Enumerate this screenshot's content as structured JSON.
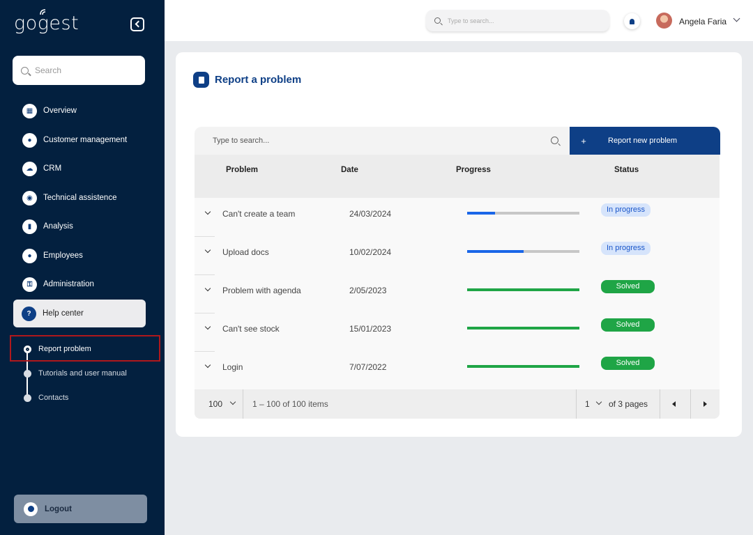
{
  "app": {
    "logo": "gogest"
  },
  "sidebar": {
    "search_placeholder": "Search",
    "items": [
      {
        "label": "Overview",
        "icon": "grid-icon"
      },
      {
        "label": "Customer management",
        "icon": "user-icon"
      },
      {
        "label": "CRM",
        "icon": "cloud-icon"
      },
      {
        "label": "Technical assistence",
        "icon": "headset-icon"
      },
      {
        "label": "Analysis",
        "icon": "chart-icon"
      },
      {
        "label": "Employees",
        "icon": "group-icon"
      },
      {
        "label": "Administration",
        "icon": "key-icon"
      },
      {
        "label": "Help center",
        "icon": "question-icon"
      }
    ],
    "subitems": [
      {
        "label": "Report problem"
      },
      {
        "label": "Tutorials and user manual"
      },
      {
        "label": "Contacts"
      }
    ],
    "logout_label": "Logout"
  },
  "topbar": {
    "search_placeholder": "Type to search...",
    "user_name": "Angela Faria"
  },
  "page": {
    "title": "Report a problem",
    "table_search_placeholder": "Type to search...",
    "add_button": "Report new problem",
    "add_symbol": "+",
    "columns": [
      "Problem",
      "Date",
      "Progress",
      "Status"
    ],
    "rows": [
      {
        "problem": "Can't create a team",
        "date": "24/03/2024",
        "progress": 0.25,
        "status": "In progress"
      },
      {
        "problem": "Upload docs",
        "date": "10/02/2024",
        "progress": 0.5,
        "status": "In progress"
      },
      {
        "problem": "Problem with agenda",
        "date": "2/05/2023",
        "progress": 1.0,
        "status": "Solved"
      },
      {
        "problem": "Can't see stock",
        "date": "15/01/2023",
        "progress": 1.0,
        "status": "Solved"
      },
      {
        "problem": "Login",
        "date": "7/07/2022",
        "progress": 1.0,
        "status": "Solved"
      }
    ],
    "pagination": {
      "page_size": "100",
      "range": "1 – 100 of 100 items",
      "current_page": "1",
      "of_pages": "of 3 pages"
    }
  },
  "colors": {
    "sidebar_bg": "#03203f",
    "accent": "#0e3f86",
    "progress_blue": "#1a66e8",
    "progress_green": "#1fa546",
    "badge_progress_bg": "#d6e4fb"
  }
}
